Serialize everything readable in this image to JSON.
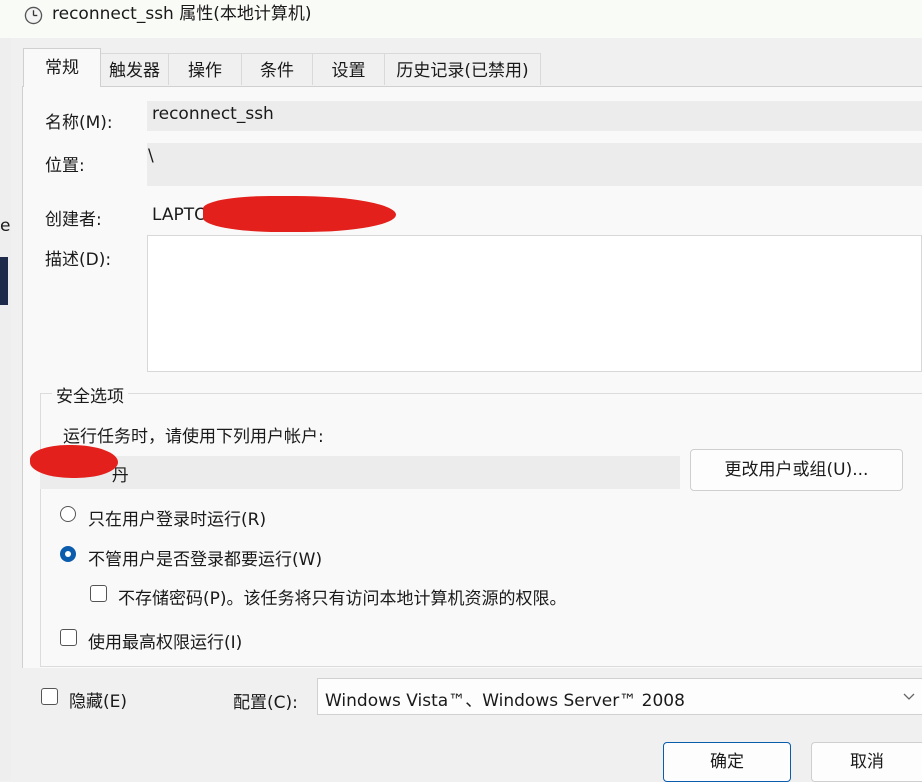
{
  "window": {
    "title": "reconnect_ssh 属性(本地计算机)",
    "icon": "clock-icon"
  },
  "background_window": {
    "text": "e"
  },
  "tabs": [
    {
      "label": "常规",
      "active": true
    },
    {
      "label": "触发器"
    },
    {
      "label": "操作"
    },
    {
      "label": "条件"
    },
    {
      "label": "设置"
    },
    {
      "label": "历史记录(已禁用)"
    }
  ],
  "general": {
    "name_label": "名称(M):",
    "name_value": "reconnect_ssh",
    "location_label": "位置:",
    "location_value": "\\",
    "author_label": "创建者:",
    "author_value": "LAPTO",
    "description_label": "描述(D):",
    "description_value": ""
  },
  "security": {
    "legend": "安全选项",
    "run_as_label": "运行任务时，请使用下列用户帐户:",
    "user_value": " 丹",
    "change_user_button": "更改用户或组(U)...",
    "radio_logged_on": "只在用户登录时运行(R)",
    "radio_whether_logged": "不管用户是否登录都要运行(W)",
    "selected_radio": "whether_logged",
    "no_store_password": "不存储密码(P)。该任务将只有访问本地计算机资源的权限。",
    "highest_privileges": "使用最高权限运行(I)"
  },
  "bottom": {
    "hidden_label": "隐藏(E)",
    "configure_label": "配置(C):",
    "configure_value": "Windows Vista™、Windows Server™ 2008",
    "ok_button": "确定",
    "cancel_button": "取消"
  },
  "colors": {
    "accent": "#0b5cad",
    "redaction": "#e3201b"
  }
}
